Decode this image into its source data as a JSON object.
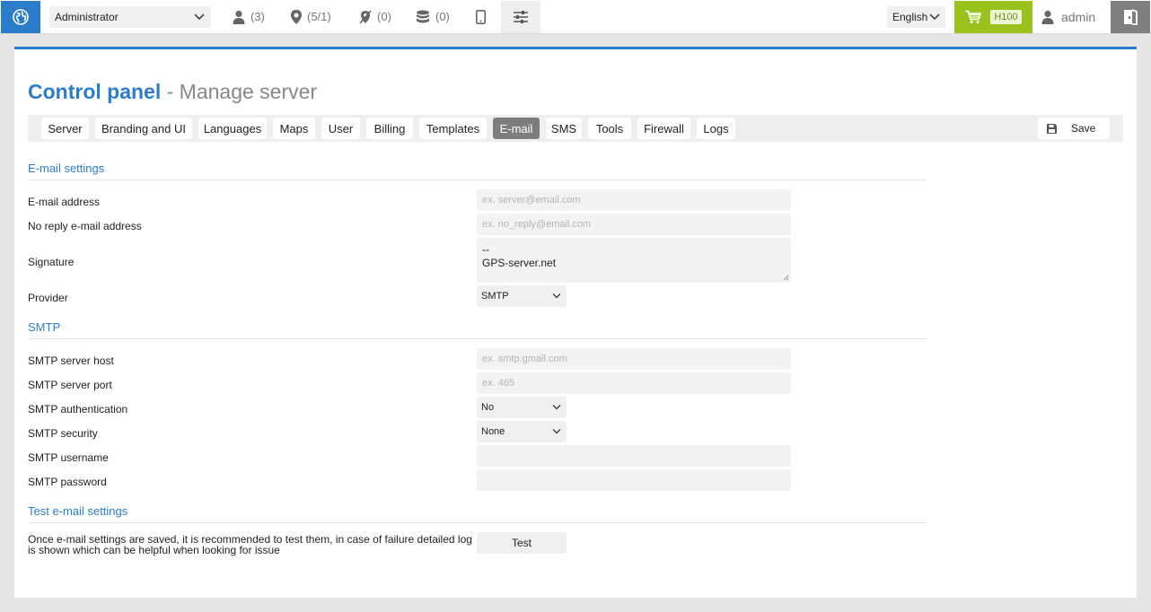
{
  "topbar": {
    "role_select": "Administrator",
    "stats": [
      {
        "icon": "user-icon",
        "value": "(3)"
      },
      {
        "icon": "map-pin-icon",
        "value": "(5/1)"
      },
      {
        "icon": "off-pin-icon",
        "value": "(0)"
      },
      {
        "icon": "database-icon",
        "value": "(0)"
      }
    ],
    "language": "English",
    "cart_badge": "H100",
    "username": "admin"
  },
  "page": {
    "title_strong": "Control panel",
    "title_rest": " - Manage server"
  },
  "tabs": [
    "Server",
    "Branding and UI",
    "Languages",
    "Maps",
    "User",
    "Billing",
    "Templates",
    "E-mail",
    "SMS",
    "Tools",
    "Firewall",
    "Logs"
  ],
  "active_tab": "E-mail",
  "save_label": "Save",
  "email_settings": {
    "title": "E-mail settings",
    "email_label": "E-mail address",
    "email_placeholder": "ex. server@email.com",
    "noreply_label": "No reply e-mail address",
    "noreply_placeholder": "ex. no_reply@email.com",
    "signature_label": "Signature",
    "signature_value": "--\nGPS-server.net",
    "provider_label": "Provider",
    "provider_value": "SMTP"
  },
  "smtp": {
    "title": "SMTP",
    "host_label": "SMTP server host",
    "host_placeholder": "ex. smtp.gmail.com",
    "port_label": "SMTP server port",
    "port_placeholder": "ex. 465",
    "auth_label": "SMTP authentication",
    "auth_value": "No",
    "security_label": "SMTP security",
    "security_value": "None",
    "username_label": "SMTP username",
    "password_label": "SMTP password"
  },
  "test": {
    "title": "Test e-mail settings",
    "note": "Once e-mail settings are saved, it is recommended to test them, in case of failure detailed log is shown which can be helpful when looking for issue",
    "button": "Test"
  },
  "colors": {
    "accent": "#2b7dcb",
    "cart": "#99c31c",
    "logout": "#7f7f7f",
    "active_tab": "#7d7d7d"
  }
}
